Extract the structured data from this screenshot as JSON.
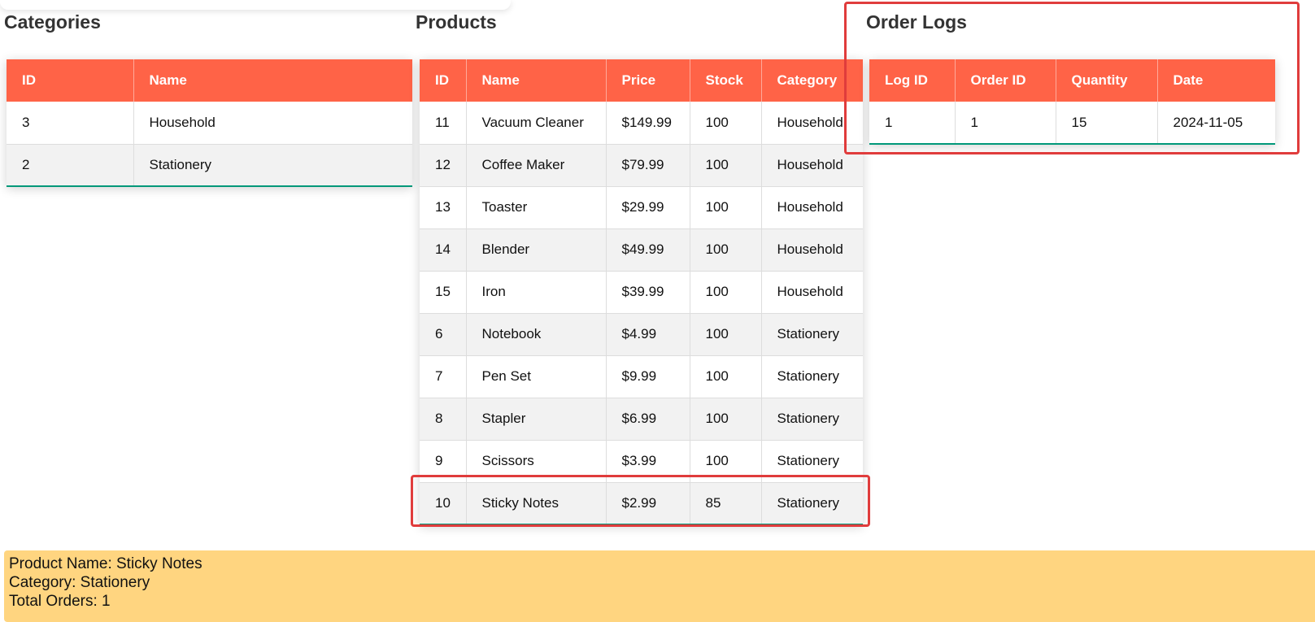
{
  "categories": {
    "title": "Categories",
    "columns": [
      "ID",
      "Name"
    ],
    "rows": [
      [
        "3",
        "Household"
      ],
      [
        "2",
        "Stationery"
      ]
    ]
  },
  "products": {
    "title": "Products",
    "columns": [
      "ID",
      "Name",
      "Price",
      "Stock",
      "Category"
    ],
    "rows": [
      [
        "11",
        "Vacuum Cleaner",
        "$149.99",
        "100",
        "Household"
      ],
      [
        "12",
        "Coffee Maker",
        "$79.99",
        "100",
        "Household"
      ],
      [
        "13",
        "Toaster",
        "$29.99",
        "100",
        "Household"
      ],
      [
        "14",
        "Blender",
        "$49.99",
        "100",
        "Household"
      ],
      [
        "15",
        "Iron",
        "$39.99",
        "100",
        "Household"
      ],
      [
        "6",
        "Notebook",
        "$4.99",
        "100",
        "Stationery"
      ],
      [
        "7",
        "Pen Set",
        "$9.99",
        "100",
        "Stationery"
      ],
      [
        "8",
        "Stapler",
        "$6.99",
        "100",
        "Stationery"
      ],
      [
        "9",
        "Scissors",
        "$3.99",
        "100",
        "Stationery"
      ],
      [
        "10",
        "Sticky Notes",
        "$2.99",
        "85",
        "Stationery"
      ]
    ]
  },
  "order_logs": {
    "title": "Order Logs",
    "columns": [
      "Log ID",
      "Order ID",
      "Quantity",
      "Date"
    ],
    "rows": [
      [
        "1",
        "1",
        "15",
        "2024-11-05"
      ]
    ]
  },
  "info": {
    "product_name": "Product Name: Sticky Notes",
    "category": "Category: Stationery",
    "total_orders": "Total Orders: 1"
  },
  "colors": {
    "header": "#ff6347",
    "highlight": "#e03c3c",
    "info_bg": "#ffd580",
    "row_accent": "#009879"
  }
}
